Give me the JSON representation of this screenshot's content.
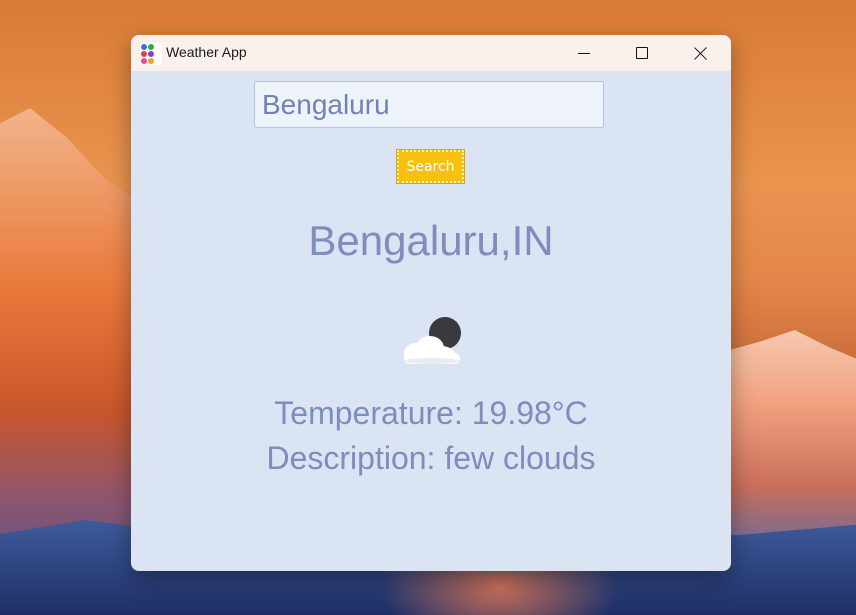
{
  "window": {
    "title": "Weather App",
    "controls": {
      "minimize": "minimize",
      "maximize": "maximize",
      "close": "close"
    }
  },
  "search": {
    "input_value": "Bengaluru",
    "button_label": "Search"
  },
  "result": {
    "city": "Bengaluru,IN",
    "icon": "moon-cloud-icon",
    "temperature": "Temperature: 19.98°C",
    "description": "Description: few clouds"
  },
  "colors": {
    "window_bg": "#dae4f3",
    "titlebar_bg": "#faf1ec",
    "text": "#7e8cbe",
    "search_button": "#f7bf0e"
  }
}
